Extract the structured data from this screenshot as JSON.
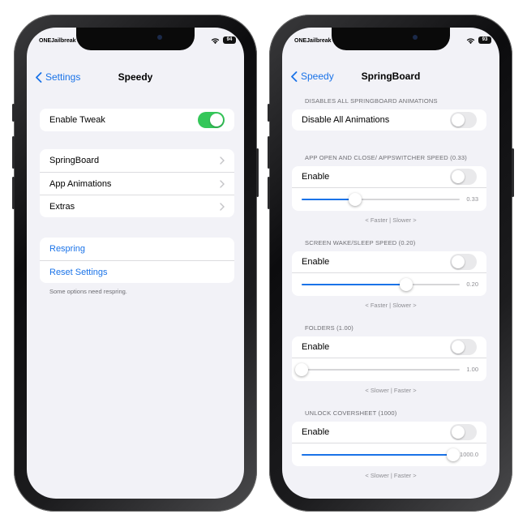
{
  "colors": {
    "accent": "#1a73e8",
    "toggle_on": "#34c759",
    "background": "#f2f2f7"
  },
  "left": {
    "status": {
      "carrier": "ONEJailbreak",
      "battery": "94"
    },
    "nav": {
      "back_label": "Settings",
      "title": "Speedy"
    },
    "enable_tweak": {
      "label": "Enable Tweak",
      "on": true
    },
    "menu": [
      {
        "label": "SpringBoard"
      },
      {
        "label": "App Animations"
      },
      {
        "label": "Extras"
      }
    ],
    "actions": [
      {
        "label": "Respring"
      },
      {
        "label": "Reset Settings"
      }
    ],
    "footnote": "Some options need respring."
  },
  "right": {
    "status": {
      "carrier": "ONEJailbreak",
      "battery": "93"
    },
    "nav": {
      "back_label": "Speedy",
      "title": "SpringBoard"
    },
    "disable_header": "DISABLES ALL SPRINGBOARD ANIMATIONS",
    "disable_all": {
      "label": "Disable All Animations",
      "on": false
    },
    "sections": [
      {
        "header": "APP OPEN AND CLOSE/ APPSWITCHER SPEED (0.33)",
        "enable_label": "Enable",
        "on": false,
        "value_text": "0.33",
        "fraction": 0.34,
        "caption": "< Faster | Slower >"
      },
      {
        "header": "SCREEN WAKE/SLEEP SPEED (0.20)",
        "enable_label": "Enable",
        "on": false,
        "value_text": "0.20",
        "fraction": 0.66,
        "caption": "< Faster | Slower >"
      },
      {
        "header": "FOLDERS (1.00)",
        "enable_label": "Enable",
        "on": false,
        "value_text": "1.00",
        "fraction": 0.0,
        "caption": "< Slower | Faster >"
      },
      {
        "header": "UNLOCK COVERSHEET (1000)",
        "enable_label": "Enable",
        "on": false,
        "value_text": "1000.0",
        "fraction": 0.96,
        "caption": "< Slower | Faster >"
      }
    ]
  }
}
